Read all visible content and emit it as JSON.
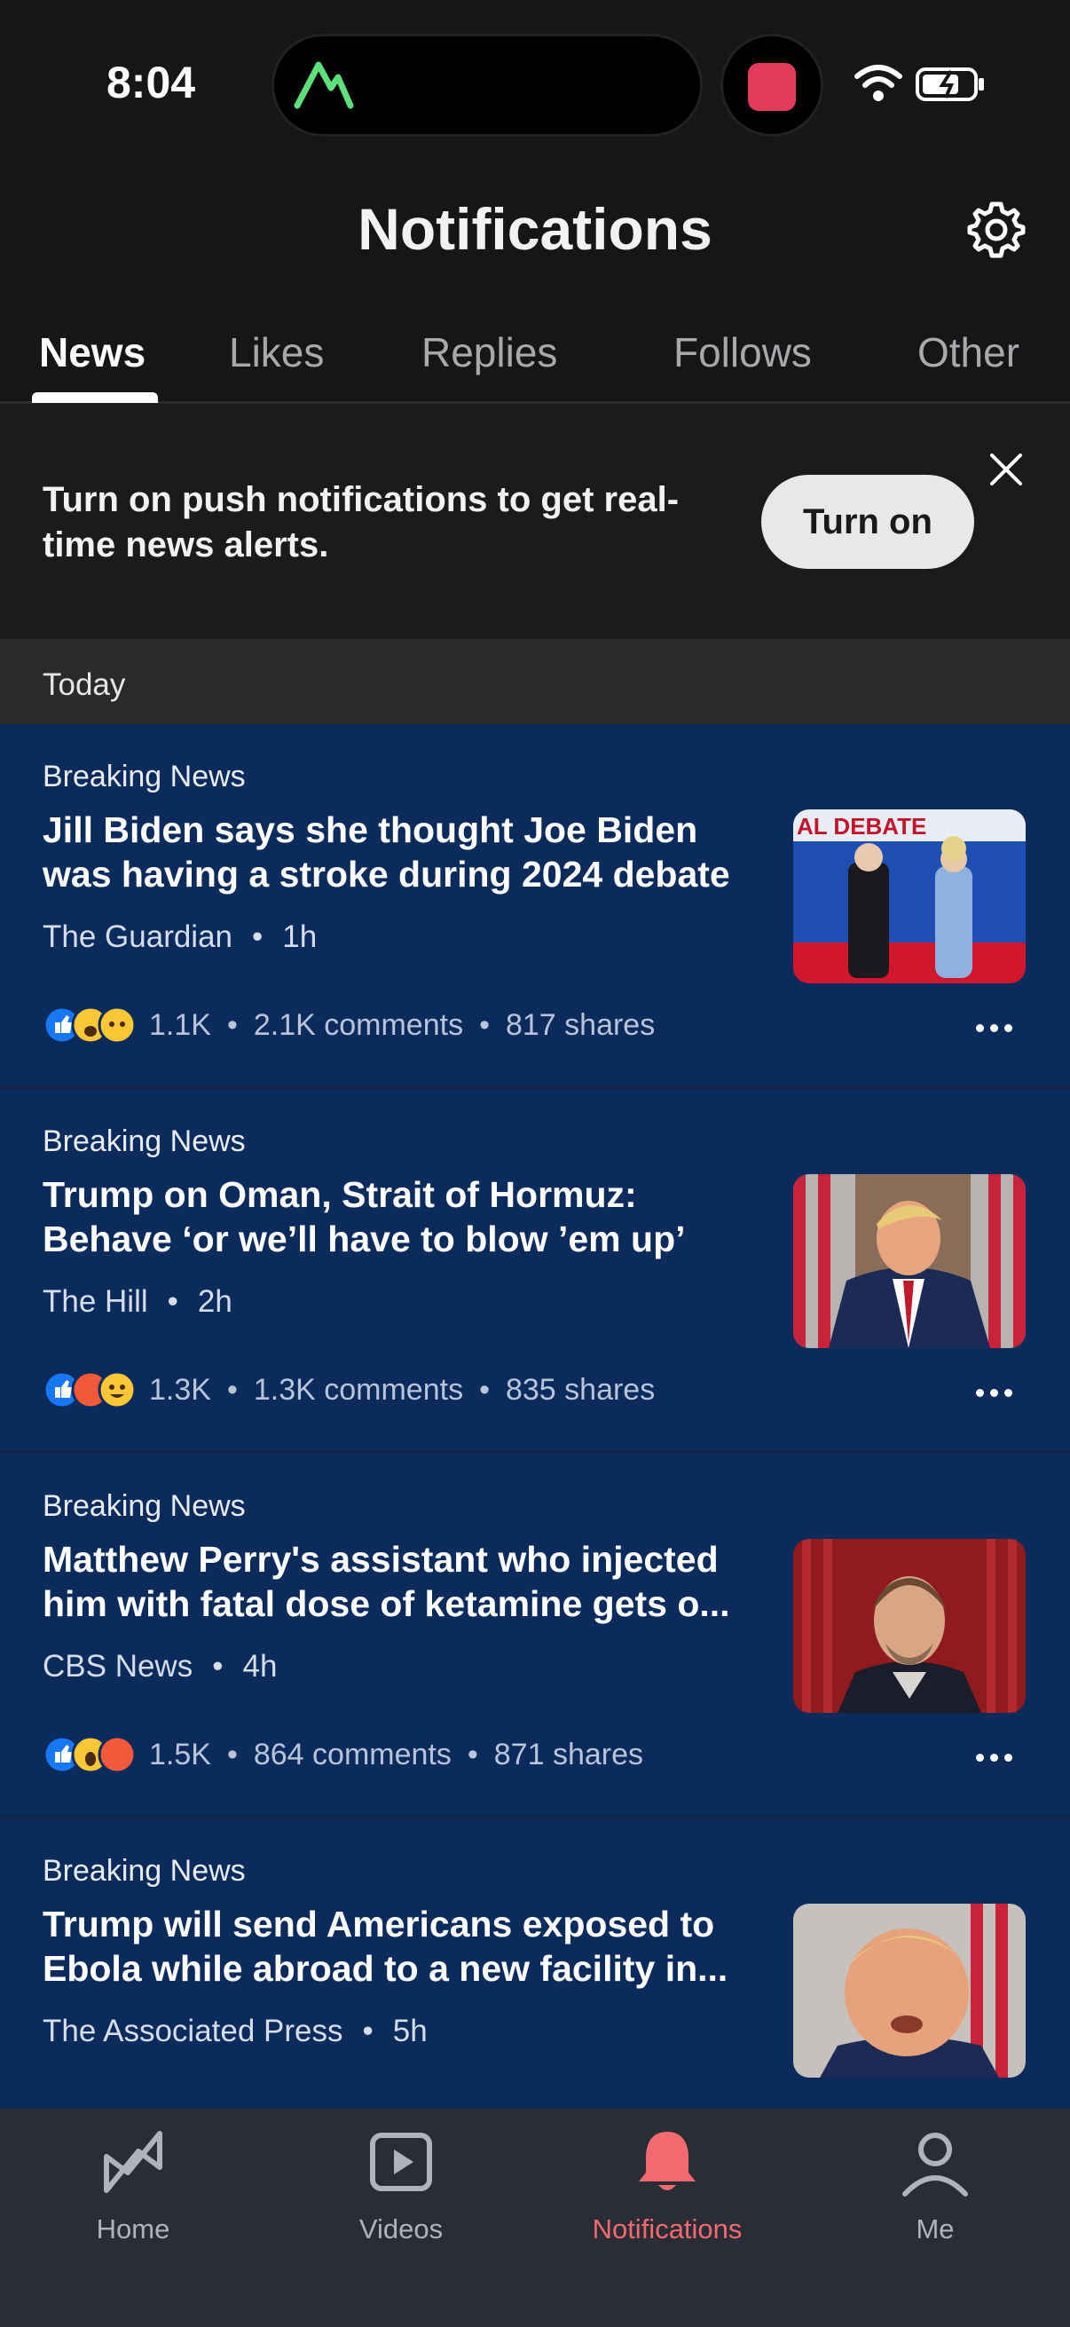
{
  "status_bar": {
    "time": "8:04"
  },
  "header": {
    "title": "Notifications"
  },
  "tabs": [
    {
      "label": "News",
      "active": true
    },
    {
      "label": "Likes",
      "active": false
    },
    {
      "label": "Replies",
      "active": false
    },
    {
      "label": "Follows",
      "active": false
    },
    {
      "label": "Other",
      "active": false
    }
  ],
  "push_banner": {
    "text": "Turn on push notifications to get real-time news alerts.",
    "button_label": "Turn on"
  },
  "section": {
    "label": "Today"
  },
  "notifications": [
    {
      "kicker": "Breaking News",
      "headline": "Jill Biden says she thought Joe Biden was having a stroke during 2024 debate",
      "source": "The Guardian",
      "time": "1h",
      "reactions": "1.1K",
      "comments": "2.1K comments",
      "shares": "817 shares",
      "thumb_text": "AL DEBATE"
    },
    {
      "kicker": "Breaking News",
      "headline": "Trump on Oman, Strait of Hormuz: Behave ‘or we’ll have to blow ’em up’",
      "source": "The Hill",
      "time": "2h",
      "reactions": "1.3K",
      "comments": "1.3K comments",
      "shares": "835 shares"
    },
    {
      "kicker": "Breaking News",
      "headline": "Matthew Perry's assistant who injected him with fatal dose of ketamine gets o...",
      "source": "CBS News",
      "time": "4h",
      "reactions": "1.5K",
      "comments": "864 comments",
      "shares": "871 shares"
    },
    {
      "kicker": "Breaking News",
      "headline": "Trump will send Americans exposed to Ebola while abroad to a new facility in...",
      "source": "The Associated Press",
      "time": "5h"
    }
  ],
  "bottom_nav": [
    {
      "label": "Home",
      "icon": "home-icon",
      "active": false
    },
    {
      "label": "Videos",
      "icon": "video-icon",
      "active": false
    },
    {
      "label": "Notifications",
      "icon": "bell-icon",
      "active": true
    },
    {
      "label": "Me",
      "icon": "person-icon",
      "active": false
    }
  ],
  "colors": {
    "background": "#161617",
    "card": "#0b2b5d",
    "accent": "#f06a6f",
    "like_blue": "#1877f2"
  }
}
